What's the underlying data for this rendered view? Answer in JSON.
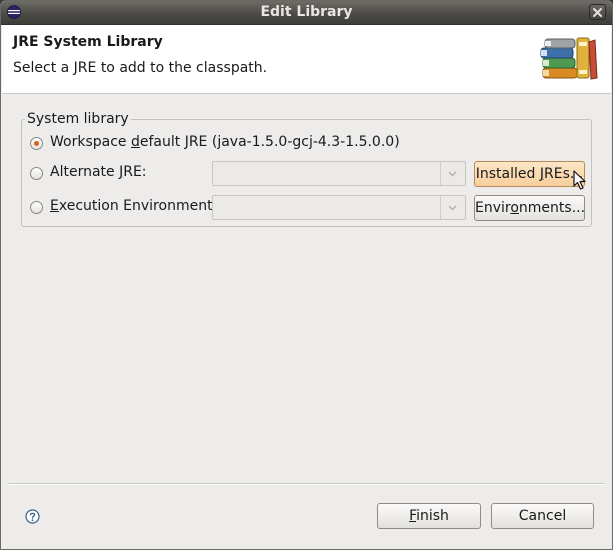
{
  "window": {
    "title": "Edit Library"
  },
  "header": {
    "title": "JRE System Library",
    "message": "Select a JRE to add to the classpath."
  },
  "system_library": {
    "group_label": "System library",
    "workspace_default": {
      "label_before": "Workspace ",
      "mnemonic": "d",
      "label_after": "efault JRE (java-1.5.0-gcj-4.3-1.5.0.0)",
      "selected": true
    },
    "alternate_jre": {
      "label_before": "Alternate ",
      "mnemonic": "J",
      "label_after": "RE:",
      "selected": false,
      "combo_value": ""
    },
    "execution_environment": {
      "label_before": "",
      "mnemonic": "E",
      "label_after": "xecution Environment:",
      "selected": false,
      "combo_value": ""
    },
    "installed_jres_button": {
      "label_before": "Installed ",
      "mnemonic": "J",
      "label_after": "REs..."
    },
    "environments_button": {
      "label_before": "Envir",
      "mnemonic": "o",
      "label_after": "nments..."
    }
  },
  "footer": {
    "finish_button": {
      "label_before": "",
      "mnemonic": "F",
      "label_after": "inish"
    },
    "cancel_button": "Cancel"
  },
  "icons": {
    "app": "eclipse-icon",
    "close": "close-icon",
    "banner": "library-books-icon",
    "help": "help-icon",
    "cursor": "mouse-pointer-icon"
  },
  "colors": {
    "titlebar": "#4d4b46",
    "dialog_bg": "#edeceb",
    "radio_selected": "#d9621a",
    "button_hover": "#f6cf9c"
  }
}
